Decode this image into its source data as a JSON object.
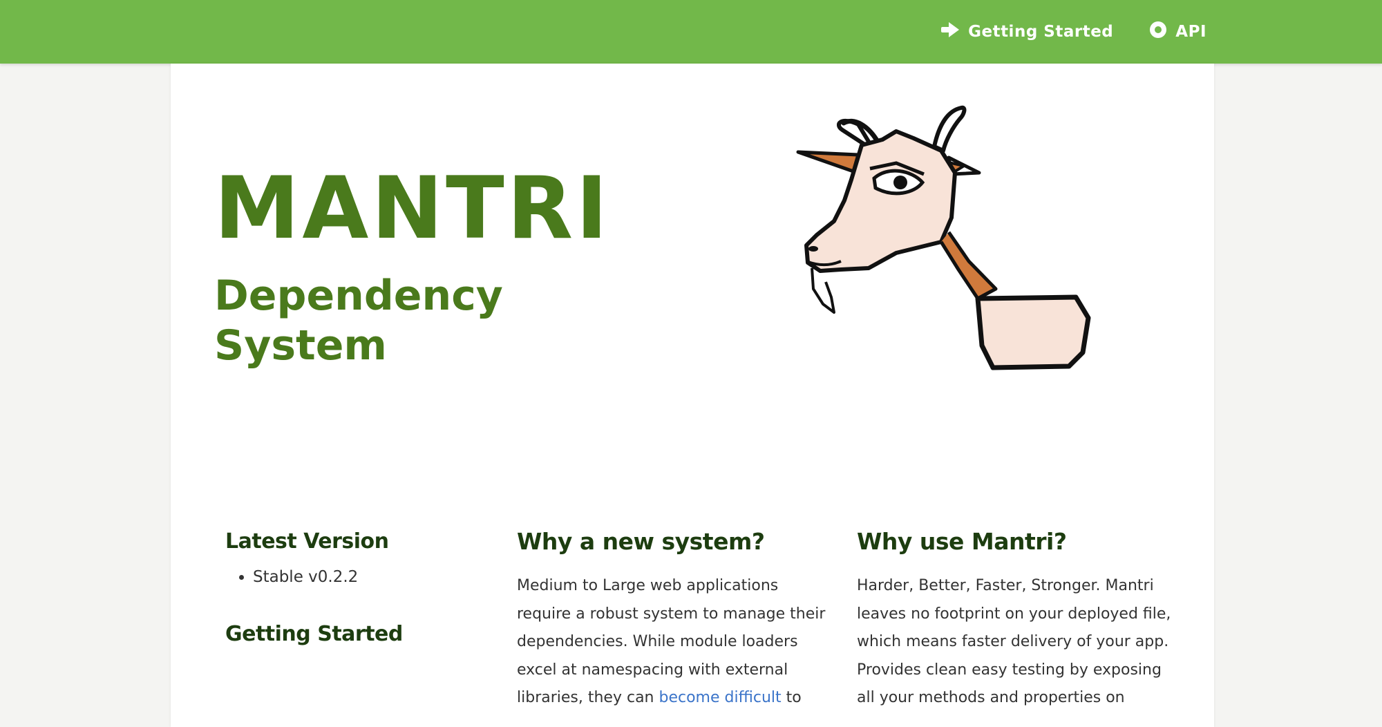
{
  "nav": {
    "getting_started": "Getting Started",
    "api": "API",
    "getting_started_icon": "arrow-right-icon",
    "api_icon": "circle-dot-icon"
  },
  "hero": {
    "title": "MANTRI",
    "subtitle": "Dependency System",
    "logo": "goat-logo"
  },
  "sections": {
    "latest_version": {
      "heading": "Latest Version",
      "items": [
        "Stable v0.2.2"
      ]
    },
    "getting_started": {
      "heading": "Getting Started"
    },
    "why_new": {
      "heading": "Why a new system?",
      "body_before_link": "Medium to Large web applications require a robust system to manage their dependencies. While module loaders excel at namespacing with external libraries, they can ",
      "link": "become difficult",
      "body_after_link": " to"
    },
    "why_mantri": {
      "heading": "Why use Mantri?",
      "body": "Harder, Better, Faster, Stronger. Mantri leaves no footprint on your deployed file, which means faster delivery of your app. Provides clean easy testing by exposing all your methods and properties on"
    }
  },
  "colors": {
    "topbar": "#72b84a",
    "hero_green": "#4a7a1c",
    "heading_dark_green": "#1d3d10",
    "link": "#3b74c9"
  }
}
